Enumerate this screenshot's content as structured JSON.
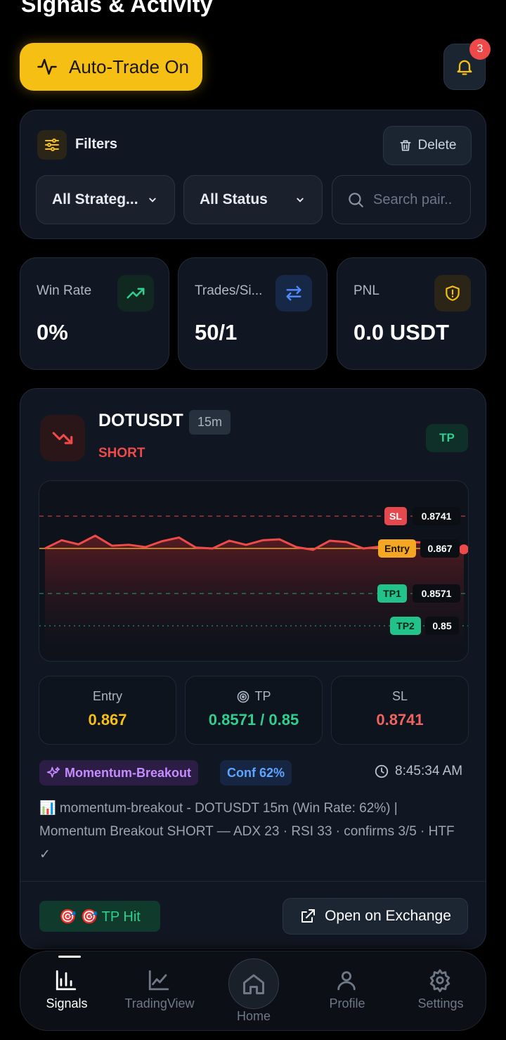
{
  "header": {
    "title": "Signals & Activity"
  },
  "auto_trade": {
    "label": "Auto-Trade On",
    "icon": "activity-icon"
  },
  "notifications": {
    "count": "3",
    "icon": "bell-icon"
  },
  "filters": {
    "label": "Filters",
    "delete_label": "Delete",
    "strategy_select": "All Strateg...",
    "status_select": "All Status",
    "search_placeholder": "Search pair..",
    "search_value": ""
  },
  "stats": [
    {
      "label": "Win Rate",
      "value": "0%",
      "icon": "trending-up-icon",
      "color": "#2fcf8f"
    },
    {
      "label": "Trades/Si...",
      "value": "50/1",
      "icon": "swap-arrows-icon",
      "color": "#4f8cff"
    },
    {
      "label": "PNL",
      "value": "0.0 USDT",
      "icon": "shield-alert-icon",
      "color": "#f5bf14"
    }
  ],
  "signal": {
    "pair": "DOTUSDT",
    "timeframe": "15m",
    "side": "SHORT",
    "status_badge": "TP",
    "levels": {
      "sl": {
        "label": "SL",
        "value": "0.8741",
        "color": "#ef4a4a"
      },
      "entry": {
        "label": "Entry",
        "value": "0.867",
        "color": "#f5a623"
      },
      "tp1": {
        "label": "TP1",
        "value": "0.8571",
        "color": "#2fcf8f"
      },
      "tp2": {
        "label": "TP2",
        "value": "0.85",
        "color": "#2fcf8f"
      }
    },
    "price_series": [
      0.867,
      0.8688,
      0.8679,
      0.8698,
      0.8676,
      0.8678,
      0.8673,
      0.8686,
      0.8694,
      0.8672,
      0.867,
      0.8687,
      0.8678,
      0.8688,
      0.869,
      0.8673,
      0.8667,
      0.8687,
      0.8684,
      0.867,
      0.8674,
      0.8677,
      0.8684,
      0.8682,
      0.8668,
      0.8668
    ],
    "metrics": {
      "entry_label": "Entry",
      "entry_value": "0.867",
      "tp_label": "TP",
      "tp_value": "0.8571 / 0.85",
      "sl_label": "SL",
      "sl_value": "0.8741"
    },
    "strategy_tag": "Momentum-Breakout",
    "confidence_tag": "Conf 62%",
    "time": "8:45:34 AM",
    "description": "📊 momentum-breakout - DOTUSDT 15m (Win Rate: 62%) | Momentum Breakout SHORT — ADX 23 · RSI 33 · confirms 3/5 · HTF ✓",
    "tp_hit_label": "🎯 🎯 TP Hit",
    "open_exchange_label": "Open on Exchange"
  },
  "nav": {
    "signals": "Signals",
    "tradingview": "TradingView",
    "home": "Home",
    "profile": "Profile",
    "settings": "Settings"
  },
  "colors": {
    "accent": "#f5bf14",
    "short": "#ef4a4a",
    "profit": "#2fcf8f",
    "info": "#4f8cff",
    "purple": "#c58cff"
  }
}
